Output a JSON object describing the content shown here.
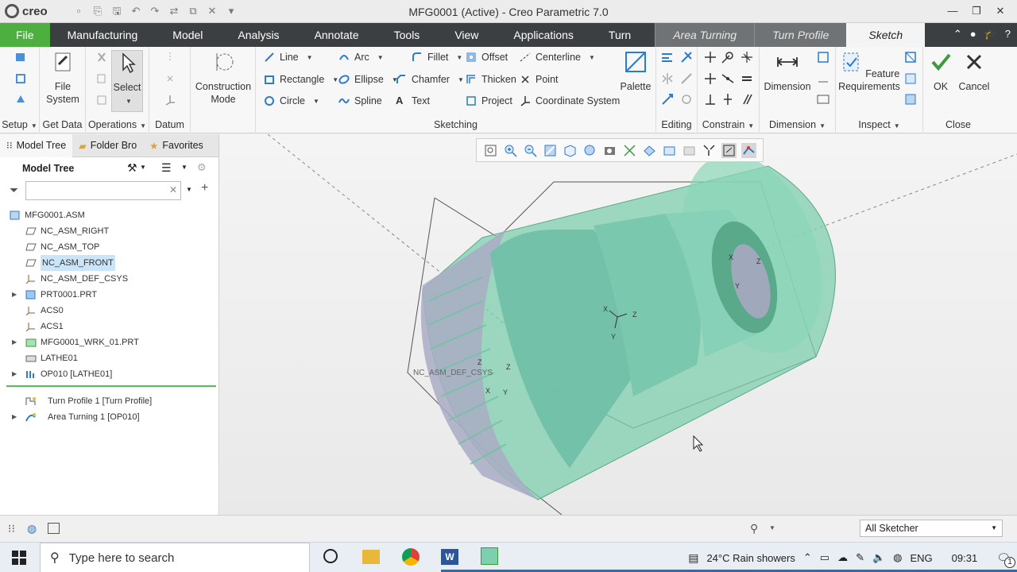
{
  "app": {
    "logo_text": "creo",
    "window_title": "MFG0001 (Active) - Creo Parametric 7.0"
  },
  "tabs": [
    {
      "label": "File"
    },
    {
      "label": "Manufacturing"
    },
    {
      "label": "Model"
    },
    {
      "label": "Analysis"
    },
    {
      "label": "Annotate"
    },
    {
      "label": "Tools"
    },
    {
      "label": "View"
    },
    {
      "label": "Applications"
    },
    {
      "label": "Turn"
    },
    {
      "label": "Area Turning"
    },
    {
      "label": "Turn Profile"
    },
    {
      "label": "Sketch"
    }
  ],
  "ribbon": {
    "setup": "Setup",
    "get_data": "Get Data",
    "file_system": "File System",
    "operations": "Operations",
    "select": "Select",
    "datum": "Datum",
    "construction_mode": "Construction Mode",
    "sketching": {
      "label": "Sketching",
      "line": "Line",
      "rectangle": "Rectangle",
      "circle": "Circle",
      "arc": "Arc",
      "ellipse": "Ellipse",
      "spline": "Spline",
      "fillet": "Fillet",
      "chamfer": "Chamfer",
      "text": "Text",
      "offset": "Offset",
      "thicken": "Thicken",
      "project": "Project",
      "centerline": "Centerline",
      "point": "Point",
      "coordinate_system": "Coordinate System",
      "palette": "Palette"
    },
    "editing": "Editing",
    "constrain": "Constrain",
    "dimension_btn": "Dimension",
    "dimension_grp": "Dimension",
    "feature_requirements": "Feature Requirements",
    "inspect": "Inspect",
    "ok": "OK",
    "cancel": "Cancel",
    "close": "Close"
  },
  "panel": {
    "tabs": [
      "Model Tree",
      "Folder Bro",
      "Favorites"
    ],
    "tree_title": "Model Tree",
    "filter_placeholder": ""
  },
  "tree": [
    {
      "label": "MFG0001.ASM"
    },
    {
      "label": "NC_ASM_RIGHT"
    },
    {
      "label": "NC_ASM_TOP"
    },
    {
      "label": "NC_ASM_FRONT"
    },
    {
      "label": "NC_ASM_DEF_CSYS"
    },
    {
      "label": "PRT0001.PRT"
    },
    {
      "label": "ACS0"
    },
    {
      "label": "ACS1"
    },
    {
      "label": "MFG0001_WRK_01.PRT"
    },
    {
      "label": "LATHE01"
    },
    {
      "label": "OP010 [LATHE01]"
    },
    {
      "label": "Turn Profile 1 [Turn Profile]"
    },
    {
      "label": "Area Turning 1 [OP010]"
    }
  ],
  "viewport": {
    "csys_label": "NC_ASM_DEF_CSYS",
    "axis_x": "X",
    "axis_y": "Y",
    "axis_z": "Z",
    "model_color": "#7ecfae"
  },
  "status": {
    "filter_value": "All Sketcher"
  },
  "taskbar": {
    "search_placeholder": "Type here to search",
    "weather": "24°C  Rain showers",
    "lang": "ENG",
    "time": "09:31",
    "notif_count": "1"
  }
}
